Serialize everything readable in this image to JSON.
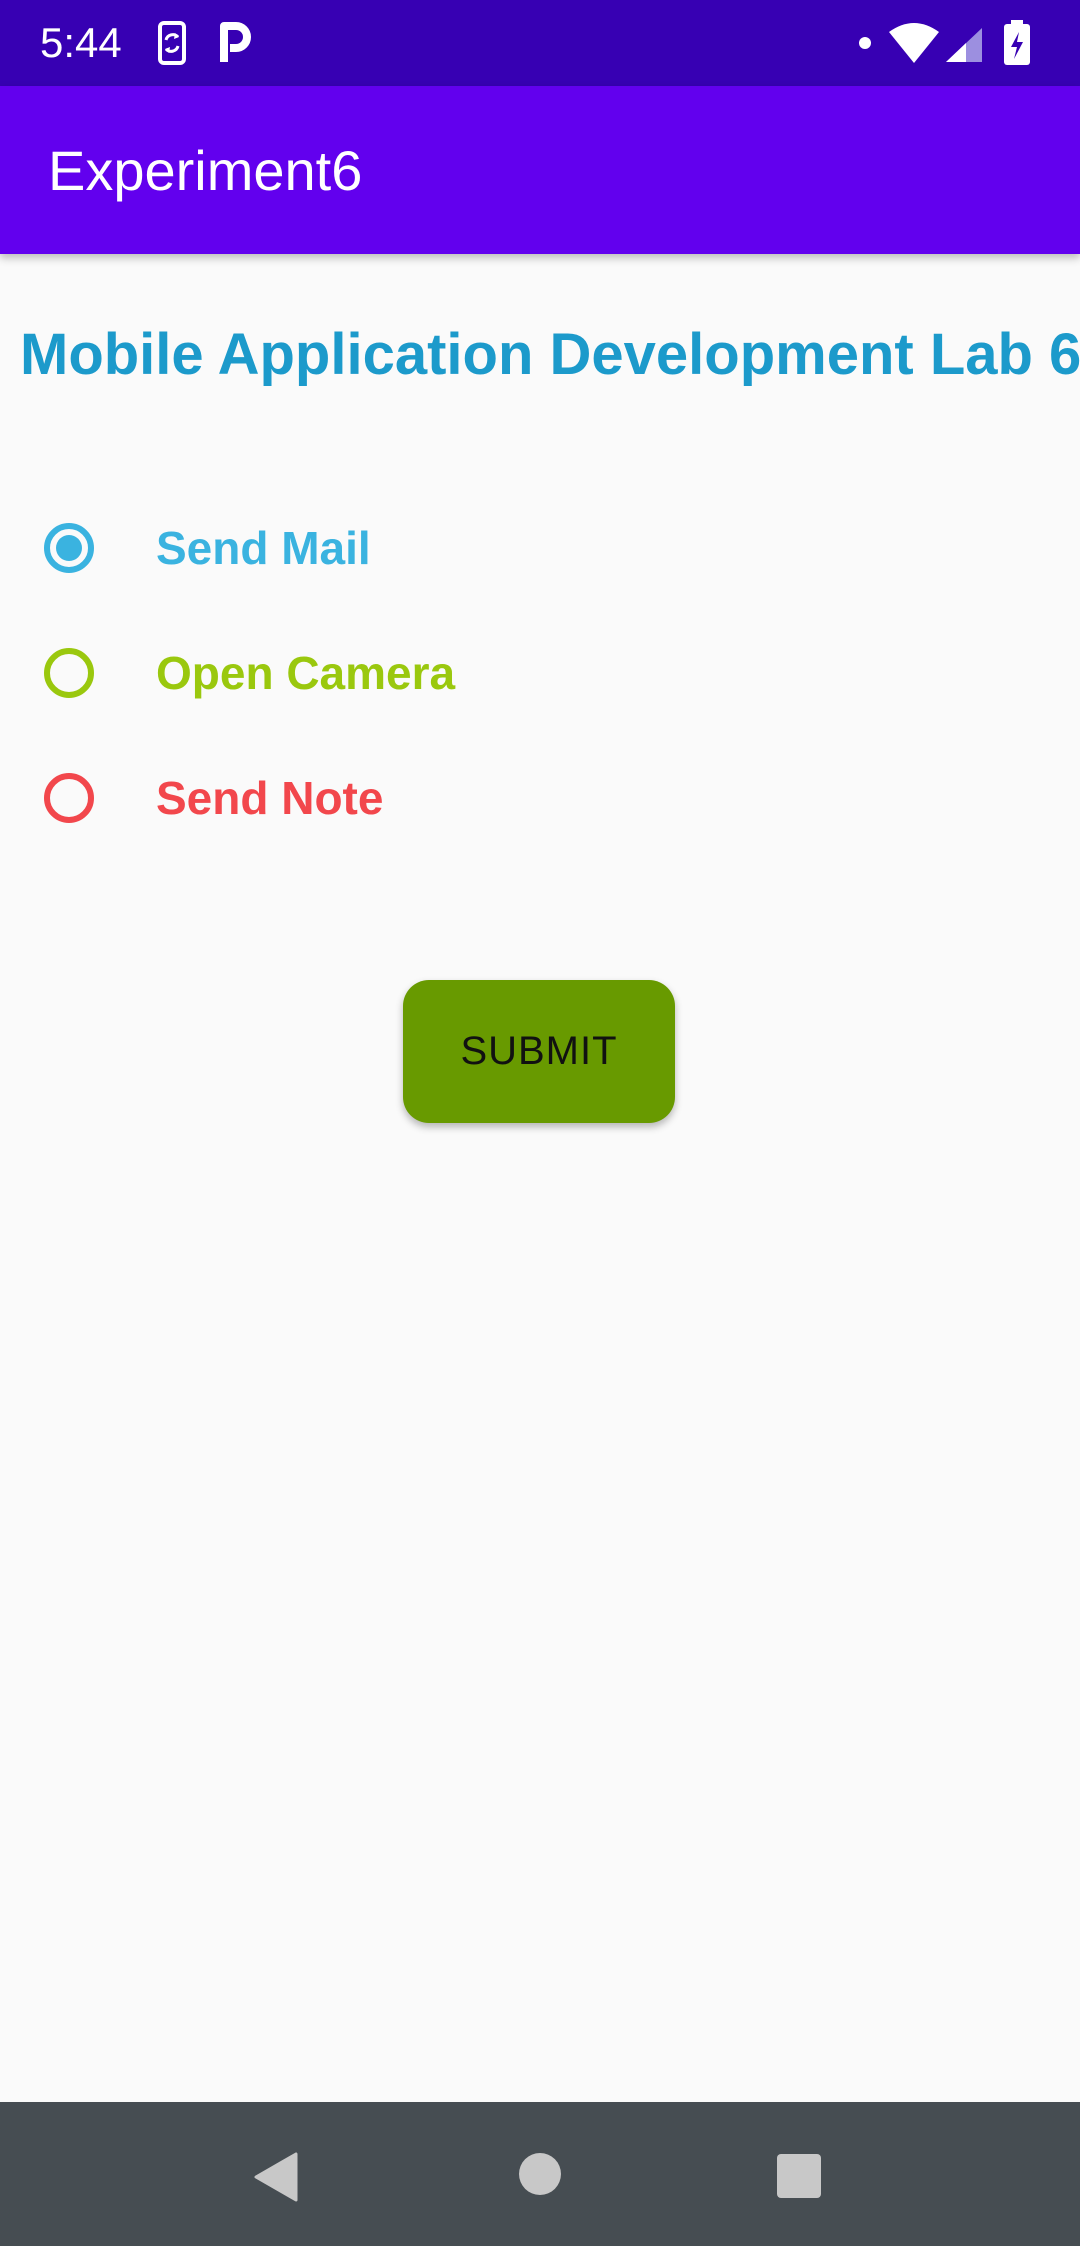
{
  "status_bar": {
    "time": "5:44",
    "icons": [
      "screen-rotate-icon",
      "parking-p-icon",
      "notification-dot-icon",
      "wifi-icon",
      "cell-signal-icon",
      "battery-charging-icon"
    ]
  },
  "app_bar": {
    "title": "Experiment6"
  },
  "main": {
    "heading": "Mobile Application Development Lab 6",
    "options": [
      {
        "label": "Send Mail",
        "checked": true,
        "color": "#3ab3e0"
      },
      {
        "label": "Open Camera",
        "checked": false,
        "color": "#9ac80e"
      },
      {
        "label": "Send Note",
        "checked": false,
        "color": "#f2474c"
      }
    ],
    "submit_label": "SUBMIT"
  },
  "nav_bar": {
    "icons": [
      "back-icon",
      "home-icon",
      "recents-icon"
    ]
  },
  "colors": {
    "status_bar": "#3700b3",
    "app_bar": "#6200ee",
    "heading": "#1c9acb",
    "submit_button": "#689a00",
    "nav_bar": "#464d52",
    "background": "#fafafa"
  }
}
